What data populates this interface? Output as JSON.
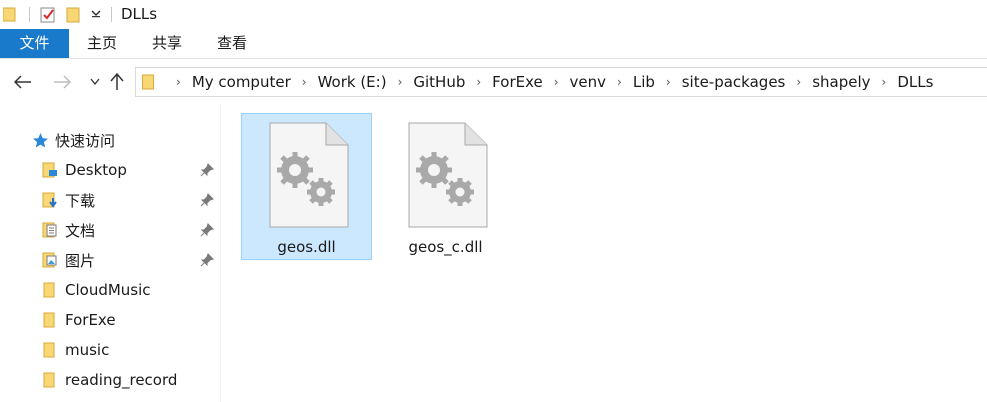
{
  "window": {
    "title": "DLLs"
  },
  "ribbon": {
    "tabs": [
      {
        "label": "文件"
      },
      {
        "label": "主页"
      },
      {
        "label": "共享"
      },
      {
        "label": "查看"
      }
    ]
  },
  "address": {
    "breadcrumbs": [
      "My computer",
      "Work (E:)",
      "GitHub",
      "ForExe",
      "venv",
      "Lib",
      "site-packages",
      "shapely",
      "DLLs"
    ]
  },
  "sidebar": {
    "quick_access": {
      "label": "快速访问",
      "icon": "star-icon"
    },
    "items": [
      {
        "label": "Desktop",
        "icon": "desktop-folder-icon",
        "pinned": true
      },
      {
        "label": "下载",
        "icon": "downloads-folder-icon",
        "pinned": true
      },
      {
        "label": "文档",
        "icon": "documents-folder-icon",
        "pinned": true
      },
      {
        "label": "图片",
        "icon": "pictures-folder-icon",
        "pinned": true
      },
      {
        "label": "CloudMusic",
        "icon": "folder-icon",
        "pinned": false
      },
      {
        "label": "ForExe",
        "icon": "folder-icon",
        "pinned": false
      },
      {
        "label": "music",
        "icon": "folder-icon",
        "pinned": false
      },
      {
        "label": "reading_record",
        "icon": "folder-icon",
        "pinned": false
      }
    ]
  },
  "files": [
    {
      "name": "geos.dll",
      "icon": "dll-file-icon",
      "selected": true
    },
    {
      "name": "geos_c.dll",
      "icon": "dll-file-icon",
      "selected": false
    }
  ],
  "colors": {
    "file_tab": "#1979ca",
    "selection_bg": "#cce8ff",
    "selection_border": "#99d1ff",
    "folder_yellow": "#f8d775",
    "quick_access_blue": "#2b88d8"
  }
}
